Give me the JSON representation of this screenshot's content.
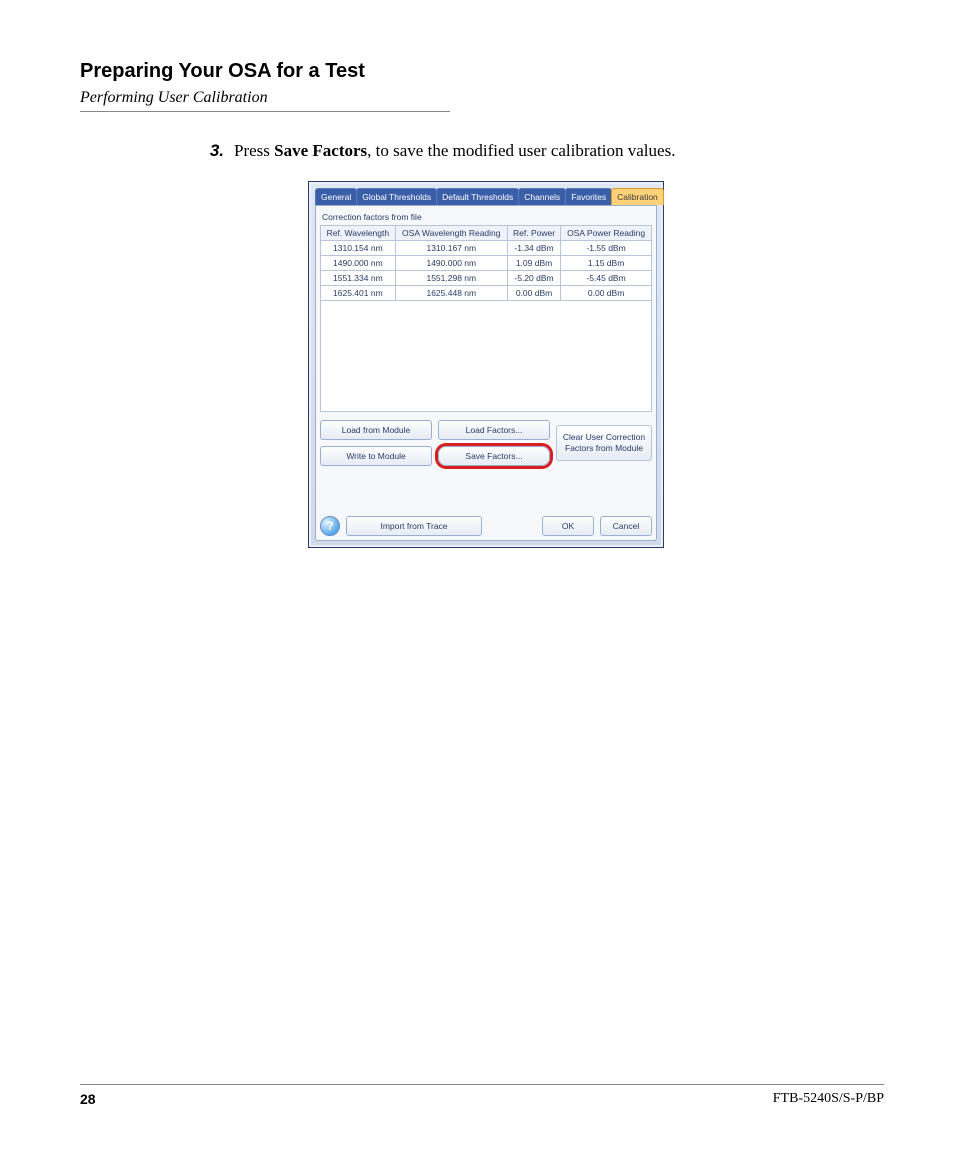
{
  "heading": "Preparing Your OSA for a Test",
  "subheading": "Performing User Calibration",
  "step": {
    "num": "3.",
    "pre": "Press ",
    "bold": "Save Factors",
    "post": ", to save the modified user calibration values."
  },
  "dialog": {
    "tabs": [
      "General",
      "Global Thresholds",
      "Default Thresholds",
      "Channels",
      "Favorites",
      "Calibration"
    ],
    "active_tab_index": 5,
    "group_title": "Correction factors from file",
    "columns": [
      "Ref. Wavelength",
      "OSA Wavelength Reading",
      "Ref. Power",
      "OSA Power Reading"
    ],
    "rows": [
      [
        "1310.154 nm",
        "1310.167 nm",
        "-1.34 dBm",
        "-1.55 dBm"
      ],
      [
        "1490.000 nm",
        "1490.000 nm",
        "1.09 dBm",
        "1.15 dBm"
      ],
      [
        "1551.334 nm",
        "1551.298 nm",
        "-5.20 dBm",
        "-5.45 dBm"
      ],
      [
        "1625.401 nm",
        "1625.448 nm",
        "0.00 dBm",
        "0.00 dBm"
      ]
    ],
    "buttons": {
      "load_module": "Load from Module",
      "load_factors": "Load Factors...",
      "write_module": "Write to Module",
      "save_factors": "Save Factors...",
      "clear": "Clear User Correction Factors from Module",
      "import": "Import from Trace",
      "ok": "OK",
      "cancel": "Cancel"
    },
    "help_glyph": "?"
  },
  "footer": {
    "page": "28",
    "model": "FTB-5240S/S-P/BP"
  }
}
